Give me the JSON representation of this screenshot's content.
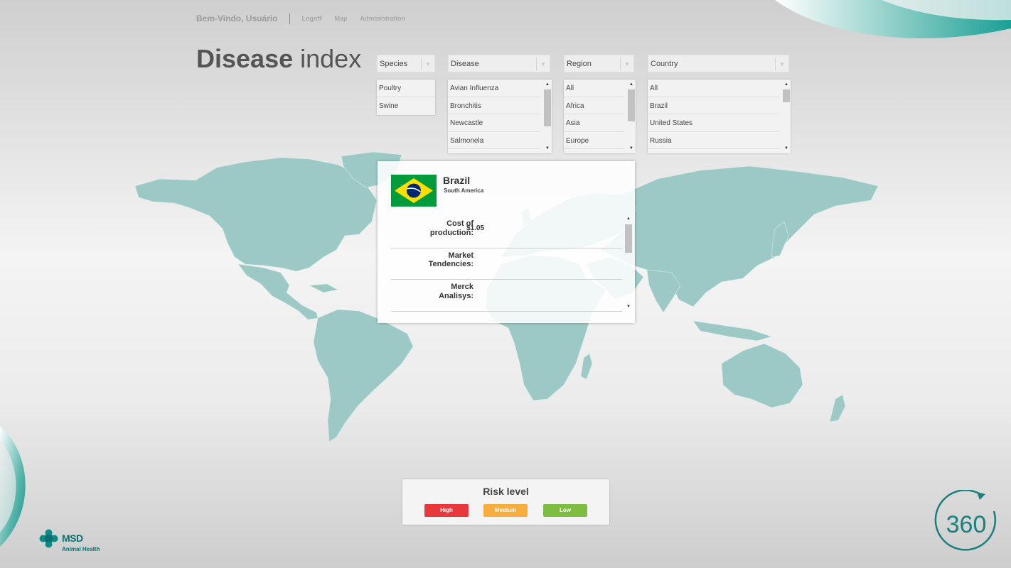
{
  "header": {
    "welcome": "Bem-Vindo, Usuário",
    "nav_links": [
      "Logoff",
      "Map",
      "Administration"
    ]
  },
  "page_title": {
    "bold": "Disease",
    "light": "index"
  },
  "filters": {
    "species": {
      "label": "Species",
      "options": [
        "Poultry",
        "Swine"
      ]
    },
    "disease": {
      "label": "Disease",
      "options": [
        "Avian Influenza",
        "Bronchitis",
        "Newcastle",
        "Salmonela"
      ]
    },
    "region": {
      "label": "Region",
      "options": [
        "All",
        "Africa",
        "Asia",
        "Europe"
      ]
    },
    "country": {
      "label": "Country",
      "options": [
        "All",
        "Brazil",
        "United States",
        "Russia"
      ]
    }
  },
  "country_card": {
    "country": "Brazil",
    "region": "South America",
    "flag_icon": "brazil-flag-icon",
    "rows": [
      {
        "label_line1": "Cost of",
        "label_line2": "production:",
        "value": "$1.05"
      },
      {
        "label_line1": "Market",
        "label_line2": "Tendencies:",
        "value": ""
      },
      {
        "label_line1": "Merck",
        "label_line2": "Analisys:",
        "value": ""
      }
    ]
  },
  "risk_legend": {
    "title": "Risk level",
    "levels": [
      {
        "label": "High",
        "color": "#e8383b"
      },
      {
        "label": "Medium",
        "color": "#f7ae3e"
      },
      {
        "label": "Low",
        "color": "#7cbd42"
      }
    ]
  },
  "branding": {
    "company": "MSD",
    "division": "Animal Health",
    "badge": "360",
    "brand_color": "#0e6f70",
    "map_color": "#9cc9c6"
  }
}
